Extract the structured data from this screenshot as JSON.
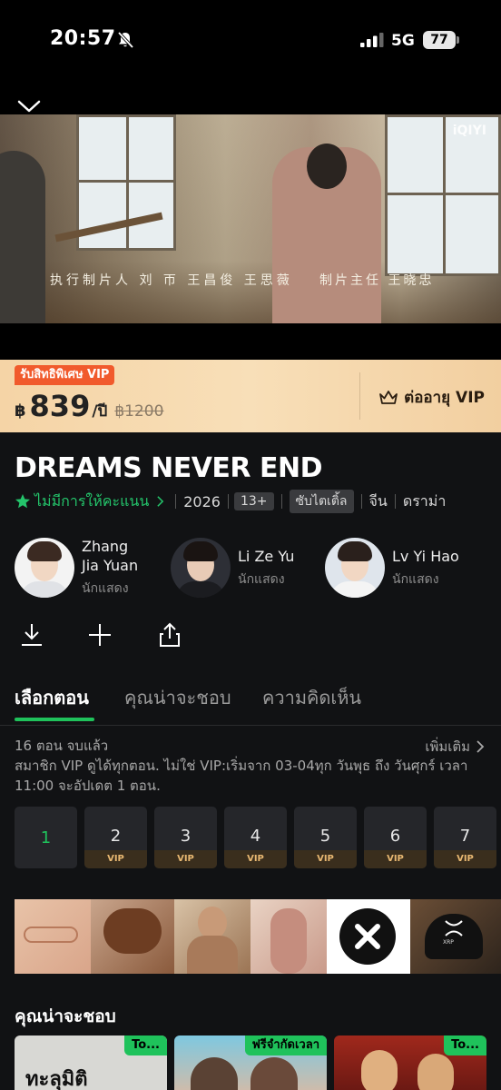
{
  "status": {
    "time": "20:57",
    "network": "5G",
    "battery": "77"
  },
  "player": {
    "watermark": "iQIYI",
    "credit_left": "执行制片人  刘 帀  王昌俊 王思薇",
    "credit_right": "制片主任  王晓忠"
  },
  "vip": {
    "tag": "รับสิทธิพิเศษ VIP",
    "currency": "฿",
    "price": "839",
    "unit": "/ปี",
    "old_price": "฿1200",
    "renew_label": "ต่ออายุ VIP"
  },
  "show": {
    "title": "DREAMS NEVER END",
    "rating": "ไม่มีการให้คะแนน",
    "year": "2026",
    "age": "13+",
    "subtitle": "ซับไตเติ้ล",
    "country": "จีน",
    "genre": "ดราม่า"
  },
  "cast": [
    {
      "name_line1": "Zhang",
      "name_line2": "Jia Yuan",
      "role": "นักแสดง"
    },
    {
      "name_line1": "Li Ze Yu",
      "name_line2": "",
      "role": "นักแสดง"
    },
    {
      "name_line1": "Lv Yi Hao",
      "name_line2": "",
      "role": "นักแสดง"
    }
  ],
  "actions": [
    "download-icon",
    "plus-icon",
    "share-icon"
  ],
  "tabs": [
    "เลือกตอน",
    "คุณน่าจะชอบ",
    "ความคิดเห็น"
  ],
  "episodes_info": {
    "status": "16 ตอน จบแล้ว",
    "more": "เพิ่มเติม",
    "schedule": "สมาชิก VIP ดูได้ทุกตอน. ไม่ใช่ VIP:เริ่มจาก 03-04ทุก วันพุธ ถึง วันศุกร์ เวลา 11:00 จะอัปเดต 1 ตอน."
  },
  "episodes": [
    {
      "num": "1",
      "vip": ""
    },
    {
      "num": "2",
      "vip": "VIP"
    },
    {
      "num": "3",
      "vip": "VIP"
    },
    {
      "num": "4",
      "vip": "VIP"
    },
    {
      "num": "5",
      "vip": "VIP"
    },
    {
      "num": "6",
      "vip": "VIP"
    },
    {
      "num": "7",
      "vip": "VIP"
    }
  ],
  "ad_strip": {
    "xrp_text": "XRP"
  },
  "recommend": {
    "title": "คุณน่าจะชอบ",
    "items": [
      {
        "badge": "To...",
        "poster_text": "ทะลุมิติ"
      },
      {
        "badge": "ฟรีจำกัดเวลา"
      },
      {
        "badge": "To..."
      }
    ]
  },
  "colors": {
    "accent": "#1fc25b",
    "vip_tag": "#f15a2c",
    "vip_gold": "#e8b872"
  }
}
